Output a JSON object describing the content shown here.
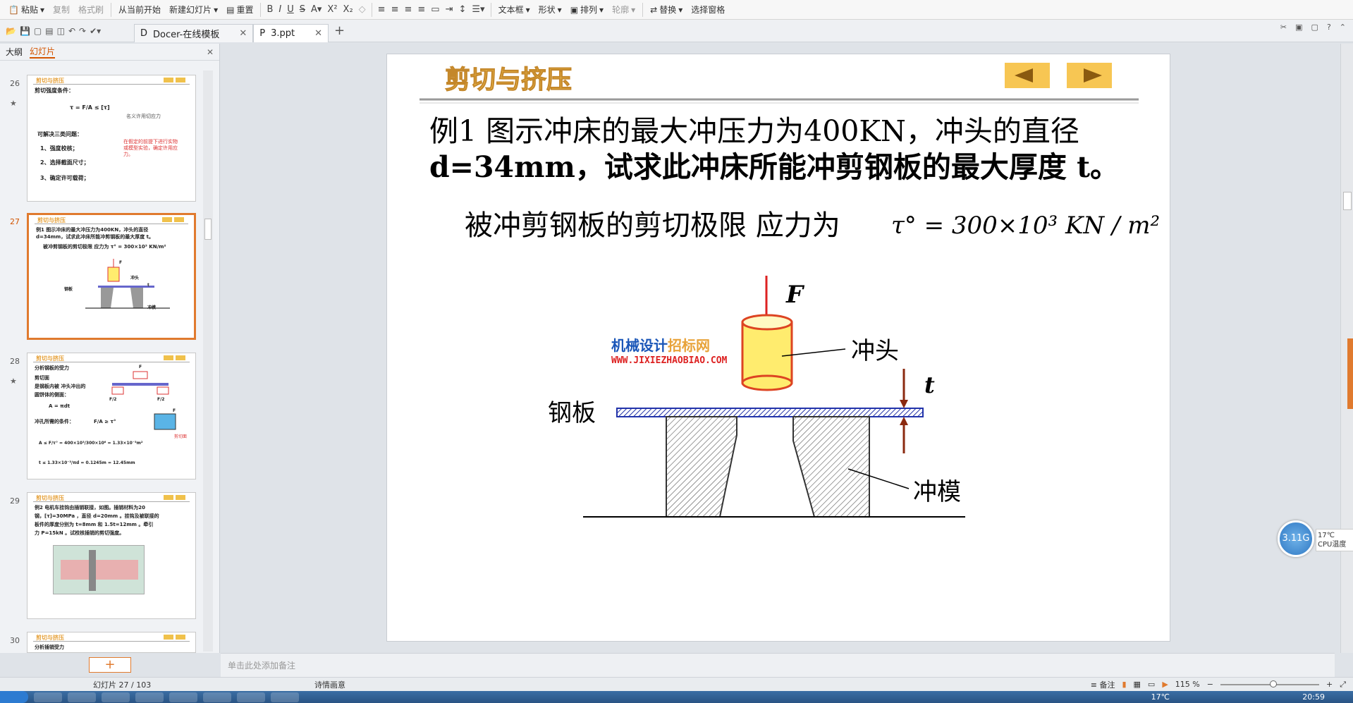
{
  "toolbar": {
    "paste": "粘贴",
    "copy": "复制",
    "format_painter": "格式刷",
    "from_current": "从当前开始",
    "new_slide": "新建幻灯片",
    "reset": "重置",
    "text_box": "文本框",
    "shape": "形状",
    "arrange": "排列",
    "outline": "轮廓",
    "replace": "替换",
    "select_pane": "选择窗格"
  },
  "tabs": [
    {
      "label": "Docer-在线模板"
    },
    {
      "label": "3.ppt"
    }
  ],
  "left_pane": {
    "tab_outline": "大纲",
    "tab_slides": "幻灯片",
    "add_slide": "+"
  },
  "thumbnails": [
    {
      "num": "26",
      "title": "剪切与挤压",
      "lines": [
        "剪切强度条件：",
        "τ = F/A ≤ [τ]",
        "可解决三类问题：",
        "1、强度校核；",
        "2、选择截面尺寸；",
        "3、确定许可载荷；"
      ],
      "note": "名义许用切应力",
      "red_note": "在假定的前提下进行实物或模型实验，确定许用应力。"
    },
    {
      "num": "27",
      "title": "剪切与挤压",
      "lines": [
        "例1  图示冲床的最大冲压力为400KN，冲头的直径",
        "d=34mm，试求此冲床所能冲剪钢板的最大厚度 t。",
        "被冲剪钢板的剪切极限 应力为  τ° = 300×10³ KN/m²"
      ],
      "labels": [
        "F",
        "冲头",
        "t",
        "钢板",
        "冲模"
      ]
    },
    {
      "num": "28",
      "title": "剪切与挤压",
      "lines": [
        "分析钢板的受力",
        "剪切面",
        "是钢板内被 冲头冲出的",
        "圆饼体的侧面：",
        "A = πdt",
        "冲孔所需的条件：",
        "F/A ≥ τ°",
        "A ≤ F/τ° = 400×10³/300×10⁶ = 1.33×10⁻³m²",
        "t ≤ 1.33×10⁻³/πd = 0.1245m = 12.45mm"
      ],
      "labels": [
        "F",
        "F/2",
        "F/2",
        "F",
        "剪切面"
      ]
    },
    {
      "num": "29",
      "title": "剪切与挤压",
      "lines": [
        "例2  电机车挂钩由插销联接，如图。插销材料为20",
        "钢，[τ]=30MPa ，直径 d=20mm 。挂钩及被联接的",
        "板件的厚度分别为 t=8mm 和 1.5t=12mm 。牵引",
        "力 P=15kN 。试校核插销的剪切强度。"
      ]
    },
    {
      "num": "30",
      "title": "剪切与挤压",
      "lines": [
        "分析插销受力"
      ]
    }
  ],
  "slide": {
    "title": "剪切与挤压",
    "problem_line1": "例1  图示冲床的最大冲压力为400KN，冲头的直径",
    "problem_line2": "d=34mm，试求此冲床所能冲剪钢板的最大厚度 t。",
    "stress_prefix": "被冲剪钢板的剪切极限 应力为",
    "stress_formula": "τ° = 300×10³ KN / m²",
    "label_F": "F",
    "label_punch": "冲头",
    "label_t": "t",
    "label_plate": "钢板",
    "label_die": "冲模",
    "watermark_cn_a": "机械设计",
    "watermark_cn_b": "招标网",
    "watermark_en": "WWW.JIXIEZHAOBIAO.COM"
  },
  "notes_placeholder": "单击此处添加备注",
  "status": {
    "slide_counter": "幻灯片 27 / 103",
    "theme": "诗情画意",
    "notes": "备注",
    "zoom": "115 %"
  },
  "cpu_widget": {
    "freq": "3.11G",
    "temp": "17℃",
    "label": "CPU温度"
  },
  "taskbar": {
    "temp": "17℃",
    "clock": "20:59"
  }
}
